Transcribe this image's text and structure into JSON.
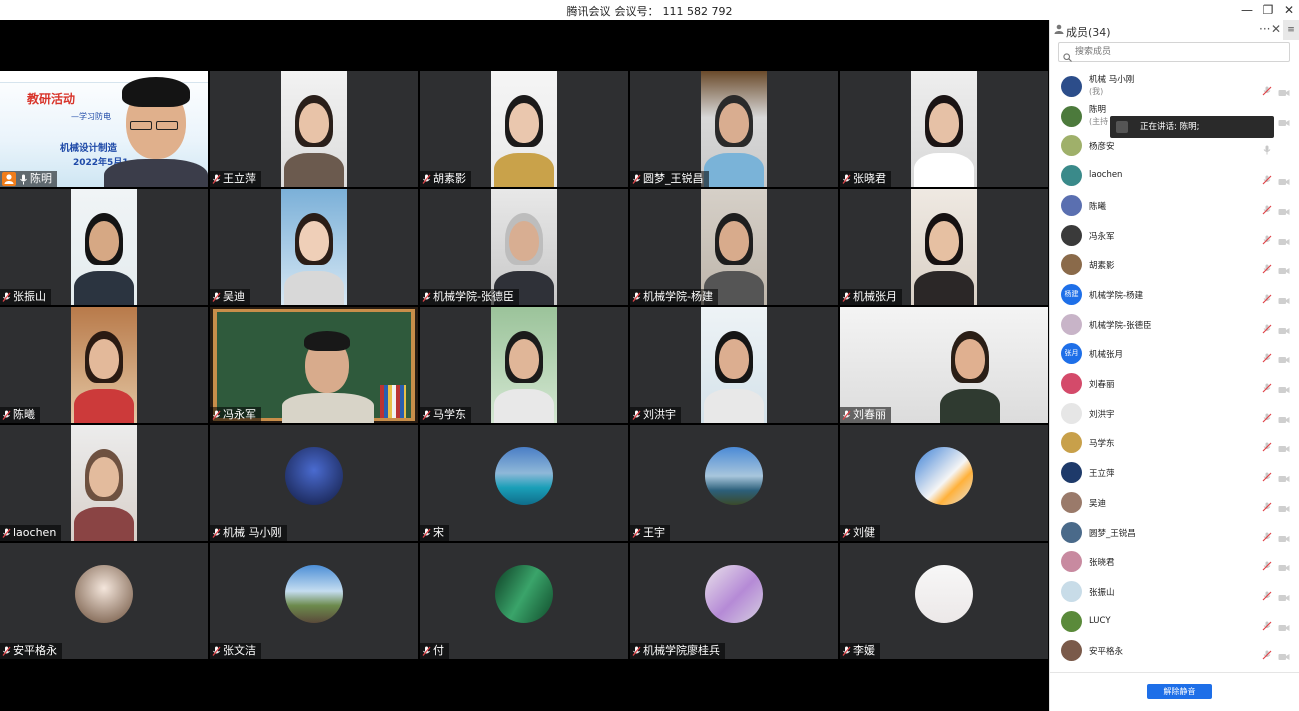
{
  "titlebar": {
    "app": "腾讯会议",
    "meeting_label": "会议号：",
    "meeting_id": "111 582 792",
    "minimize": "—",
    "restore": "❐",
    "close": "✕"
  },
  "active_slide": {
    "line1": "教研活动",
    "line2": "—学习防电",
    "line3": "机械设计制造",
    "line4": "2022年5月1"
  },
  "tiles": [
    {
      "name": "陈明"
    },
    {
      "name": "王立萍"
    },
    {
      "name": "胡素影"
    },
    {
      "name": "圆梦_王锐昌"
    },
    {
      "name": "张晓君"
    },
    {
      "name": "张振山"
    },
    {
      "name": "吴迪"
    },
    {
      "name": "机械学院-张德臣"
    },
    {
      "name": "机械学院-杨建"
    },
    {
      "name": "机械张月"
    },
    {
      "name": "陈曦"
    },
    {
      "name": "冯永军"
    },
    {
      "name": "马学东"
    },
    {
      "name": "刘洪宇"
    },
    {
      "name": "刘春丽"
    },
    {
      "name": "laochen"
    },
    {
      "name": "机械 马小刚"
    },
    {
      "name": "宋"
    },
    {
      "name": "王宇"
    },
    {
      "name": "刘健"
    },
    {
      "name": "安平格永"
    },
    {
      "name": "张文洁"
    },
    {
      "name": "付"
    },
    {
      "name": "机械学院廖桂兵"
    },
    {
      "name": "李媛"
    }
  ],
  "panel": {
    "title": "成员(34)",
    "more": "···",
    "close": "✕",
    "menu": "≡",
    "search_placeholder": "搜索成员",
    "speaking_label": "正在讲话: 陈明;",
    "unmute_all": "解除静音",
    "members": [
      {
        "name": "机械 马小刚",
        "sub": "(我)",
        "avatar_text": ""
      },
      {
        "name": "陈明",
        "sub": "(主持",
        "avatar_text": ""
      },
      {
        "name": "杨彦安",
        "sub": "",
        "avatar_text": ""
      },
      {
        "name": "laochen",
        "sub": "",
        "avatar_text": ""
      },
      {
        "name": "陈曦",
        "sub": "",
        "avatar_text": ""
      },
      {
        "name": "冯永军",
        "sub": "",
        "avatar_text": ""
      },
      {
        "name": "胡素影",
        "sub": "",
        "avatar_text": ""
      },
      {
        "name": "机械学院-杨建",
        "sub": "",
        "avatar_text": "杨建"
      },
      {
        "name": "机械学院-张德臣",
        "sub": "",
        "avatar_text": ""
      },
      {
        "name": "机械张月",
        "sub": "",
        "avatar_text": "张月"
      },
      {
        "name": "刘春丽",
        "sub": "",
        "avatar_text": ""
      },
      {
        "name": "刘洪宇",
        "sub": "",
        "avatar_text": ""
      },
      {
        "name": "马学东",
        "sub": "",
        "avatar_text": ""
      },
      {
        "name": "王立萍",
        "sub": "",
        "avatar_text": ""
      },
      {
        "name": "吴迪",
        "sub": "",
        "avatar_text": ""
      },
      {
        "name": "圆梦_王锐昌",
        "sub": "",
        "avatar_text": ""
      },
      {
        "name": "张晓君",
        "sub": "",
        "avatar_text": ""
      },
      {
        "name": "张振山",
        "sub": "",
        "avatar_text": ""
      },
      {
        "name": "LUCY",
        "sub": "",
        "avatar_text": ""
      },
      {
        "name": "安平格永",
        "sub": "",
        "avatar_text": ""
      }
    ]
  },
  "colors": {
    "active_border": "#2bd55b",
    "muted_red": "#e0454a",
    "tile_bg": "#2e2f31",
    "button_blue": "#1e6fe8",
    "host_badge": "#f07d1a"
  }
}
